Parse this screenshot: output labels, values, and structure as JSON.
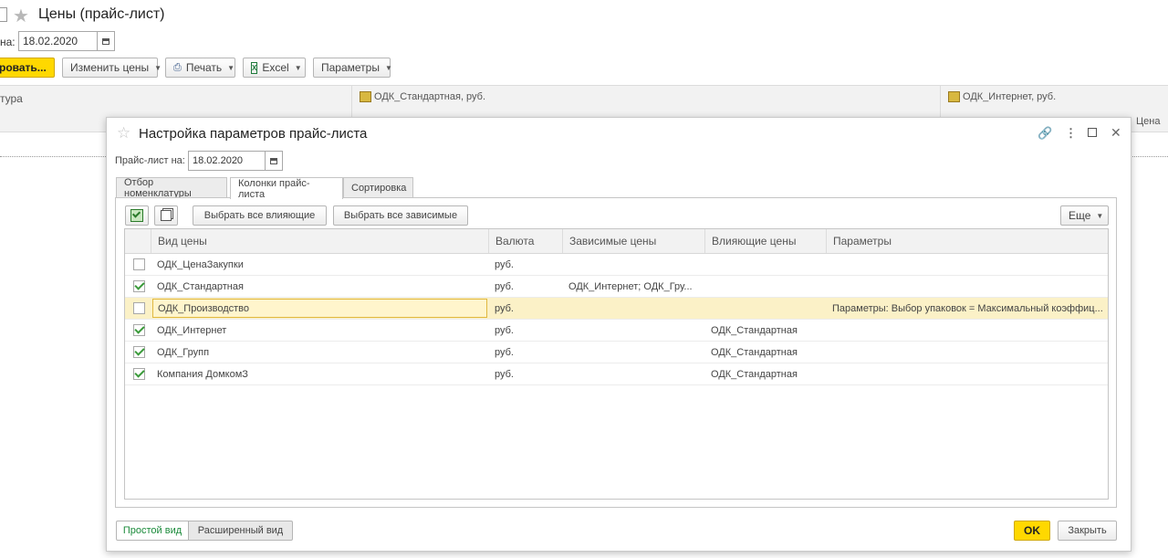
{
  "main": {
    "title": "Цены (прайс-лист)",
    "date_label": "на:",
    "date_value": "18.02.2020",
    "toolbar": {
      "primary_label": "ровать...",
      "change_prices": "Изменить цены",
      "print": "Печать",
      "excel": "Excel",
      "params": "Параметры"
    },
    "list_header": {
      "col1": "тура",
      "col2": "ОДК_Стандартная, руб.",
      "col3": "ОДК_Интернет, руб.",
      "col4": "Цена"
    }
  },
  "dialog": {
    "title": "Настройка параметров прайс-листа",
    "date_label": "Прайс-лист на:",
    "date_value": "18.02.2020",
    "tabs": [
      "Отбор номенклатуры",
      "Колонки прайс-листа",
      "Сортировка"
    ],
    "active_tab": 1,
    "toolbar": {
      "select_influencing": "Выбрать все влияющие",
      "select_dependent": "Выбрать все зависимые",
      "more": "Еще"
    },
    "columns": {
      "price_type": "Вид цены",
      "currency": "Валюта",
      "dependent": "Зависимые цены",
      "influencing": "Влияющие цены",
      "params": "Параметры"
    },
    "rows": [
      {
        "checked": false,
        "name": "ОДК_ЦенаЗакупки",
        "currency": "руб.",
        "dependent": "",
        "influencing": "",
        "params": ""
      },
      {
        "checked": true,
        "name": "ОДК_Стандартная",
        "currency": "руб.",
        "dependent": "ОДК_Интернет; ОДК_Гру...",
        "influencing": "",
        "params": ""
      },
      {
        "checked": false,
        "name": "ОДК_Производство",
        "currency": "руб.",
        "dependent": "",
        "influencing": "",
        "params": "Параметры: Выбор упаковок = Максимальный коэффиц..."
      },
      {
        "checked": true,
        "name": "ОДК_Интернет",
        "currency": "руб.",
        "dependent": "",
        "influencing": "ОДК_Стандартная",
        "params": ""
      },
      {
        "checked": true,
        "name": "ОДК_Групп",
        "currency": "руб.",
        "dependent": "",
        "influencing": "ОДК_Стандартная",
        "params": ""
      },
      {
        "checked": true,
        "name": "Компания ДомкомЗ",
        "currency": "руб.",
        "dependent": "",
        "influencing": "ОДК_Стандартная",
        "params": ""
      }
    ],
    "selected_row": 2,
    "footer": {
      "simple_view": "Простой вид",
      "extended_view": "Расширенный вид",
      "ok": "OK",
      "close": "Закрыть"
    }
  },
  "colors": {
    "accent_yellow": "#ffd800",
    "selected_row": "#fbf1c7",
    "check_green": "#3a9a3a",
    "link_green": "#1a8a3a"
  }
}
